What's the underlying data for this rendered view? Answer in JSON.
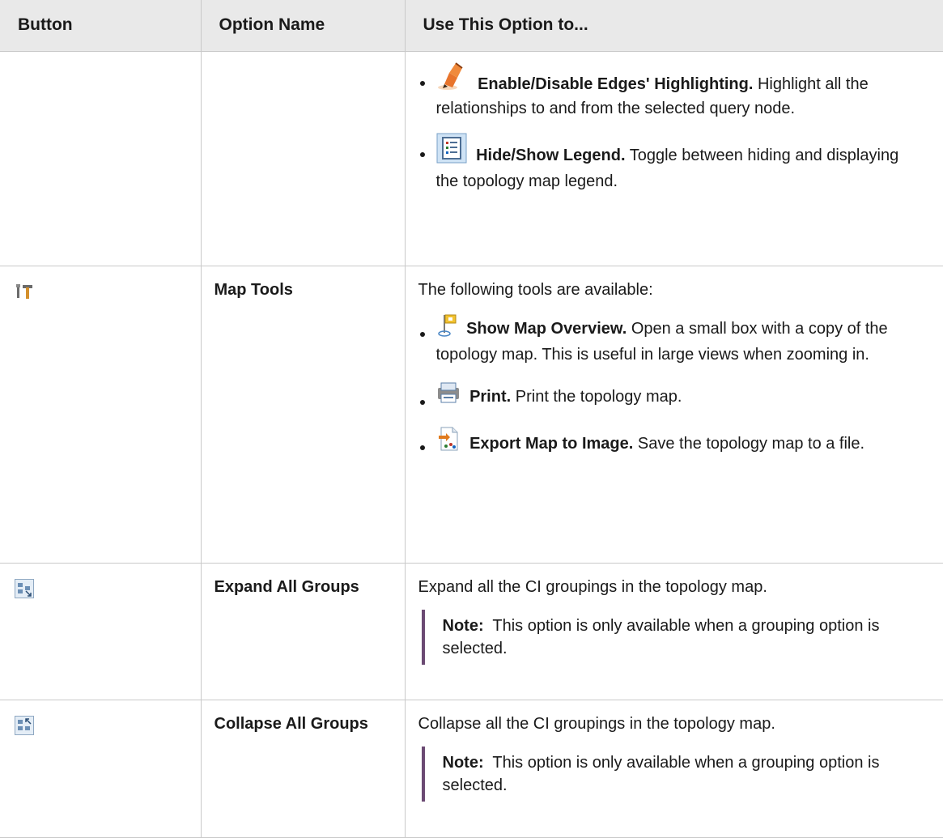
{
  "table": {
    "headers": [
      "Button",
      "Option Name",
      "Use This Option to..."
    ],
    "row0": {
      "items": [
        {
          "icon": "highlighter-icon",
          "title": "Enable/Disable Edges' Highlighting.",
          "text": "Highlight all the relationships to and from the selected query node."
        },
        {
          "icon": "legend-icon",
          "title": "Hide/Show Legend.",
          "text": "Toggle between hiding and displaying the topology map legend."
        }
      ]
    },
    "row1": {
      "button_icon": "map-tools-icon",
      "name": "Map Tools",
      "intro": "The following tools are available:",
      "items": [
        {
          "icon": "map-overview-icon",
          "title": "Show Map Overview.",
          "text": "Open a small box with a copy of the topology map. This is useful in large views when zooming in."
        },
        {
          "icon": "print-icon",
          "title": "Print.",
          "text": "Print the topology map."
        },
        {
          "icon": "export-image-icon",
          "title": "Export Map to Image.",
          "text": "Save the topology map to a file."
        }
      ]
    },
    "row2": {
      "button_icon": "expand-groups-icon",
      "name": "Expand All Groups",
      "desc": "Expand all the CI groupings in the topology map.",
      "note_label": "Note:",
      "note_text": "This option is only available when a grouping option is selected."
    },
    "row3": {
      "button_icon": "collapse-groups-icon",
      "name": "Collapse All Groups",
      "desc": "Collapse all the CI groupings in the topology map.",
      "note_label": "Note:",
      "note_text": "This option is only available when a grouping option is selected."
    }
  }
}
